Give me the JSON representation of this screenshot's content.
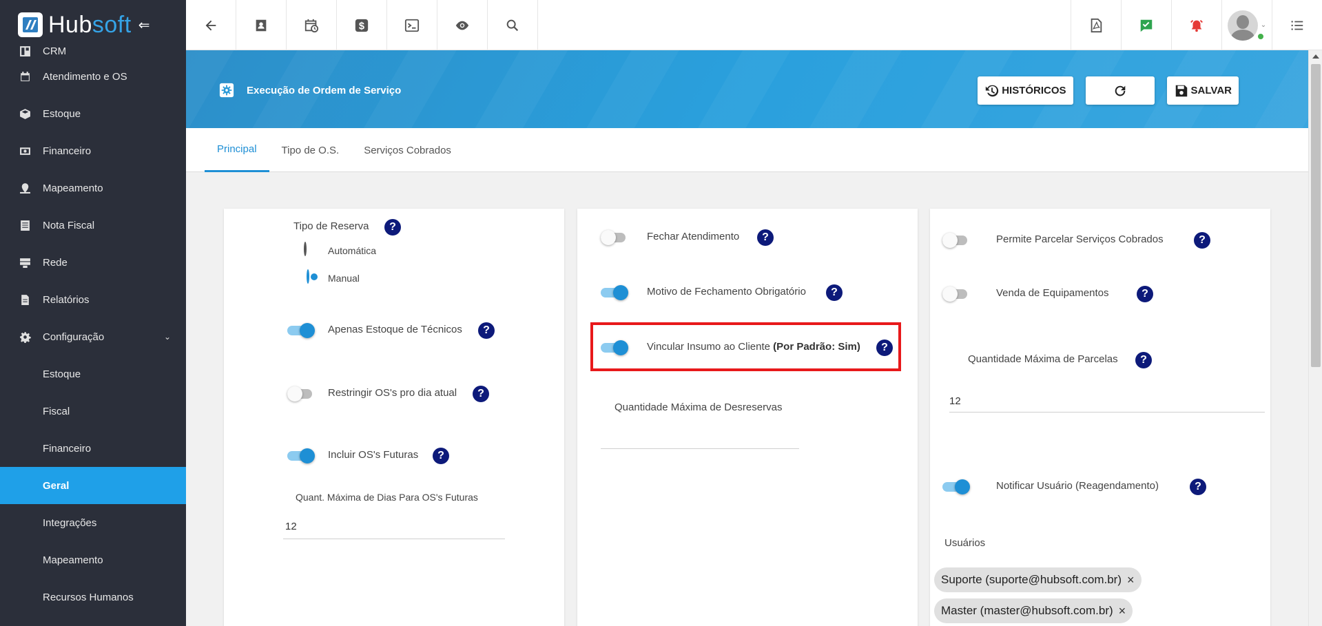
{
  "brand": {
    "name_part1": "Hub",
    "name_part2": "soft",
    "collapse_glyph": "⇐"
  },
  "sidebar": {
    "items": [
      {
        "label": "CRM",
        "icon": "crm-icon"
      },
      {
        "label": "Atendimento e OS",
        "icon": "calendar-clock-icon"
      },
      {
        "label": "Estoque",
        "icon": "box-icon"
      },
      {
        "label": "Financeiro",
        "icon": "money-icon"
      },
      {
        "label": "Mapeamento",
        "icon": "map-pin-icon"
      },
      {
        "label": "Nota Fiscal",
        "icon": "receipt-icon"
      },
      {
        "label": "Rede",
        "icon": "server-icon"
      },
      {
        "label": "Relatórios",
        "icon": "report-icon"
      },
      {
        "label": "Configuração",
        "icon": "gear-icon"
      }
    ],
    "sub_items": [
      "Estoque",
      "Fiscal",
      "Financeiro",
      "Geral",
      "Integrações",
      "Mapeamento",
      "Recursos Humanos"
    ],
    "active_sub": "Geral"
  },
  "topbar": {
    "left_icons": [
      "back-arrow-icon",
      "contact-icon",
      "calendar-icon",
      "dollar-icon",
      "terminal-icon",
      "eye-icon",
      "search-icon"
    ],
    "right_icons": [
      "pdf-icon",
      "task-check-icon",
      "alarm-icon",
      "user-avatar",
      "list-menu-icon"
    ]
  },
  "header": {
    "title": "Execução de Ordem de Serviço",
    "historicos_label": "HISTÓRICOS",
    "salvar_label": "SALVAR"
  },
  "tabs": [
    {
      "label": "Principal",
      "active": true
    },
    {
      "label": "Tipo de O.S.",
      "active": false
    },
    {
      "label": "Serviços Cobrados",
      "active": false
    }
  ],
  "card1": {
    "tipo_reserva_label": "Tipo de Reserva",
    "radio_automatica": "Automática",
    "radio_manual": "Manual",
    "selected": "Manual",
    "apenas_estoque": {
      "label": "Apenas Estoque de Técnicos",
      "on": true
    },
    "restringir": {
      "label": "Restringir OS's pro dia atual",
      "on": false
    },
    "incluir_futuras": {
      "label": "Incluir OS's Futuras",
      "on": true
    },
    "quant_dias_label": "Quant. Máxima de Dias Para OS's Futuras",
    "quant_dias_value": "12"
  },
  "card2": {
    "fechar_atendimento": {
      "label": "Fechar Atendimento",
      "on": false
    },
    "motivo_fechamento": {
      "label": "Motivo de Fechamento Obrigatório",
      "on": true
    },
    "vincular_insumo": {
      "label": "Vincular Insumo ao Cliente",
      "bold_suffix": "(Por Padrão: Sim)",
      "on": true
    },
    "qtd_desreservas_label": "Quantidade Máxima de Desreservas",
    "qtd_desreservas_value": ""
  },
  "card3": {
    "permite_parcelar": {
      "label": "Permite Parcelar Serviços Cobrados",
      "on": false
    },
    "venda_equipamentos": {
      "label": "Venda de Equipamentos",
      "on": false
    },
    "qtd_parcelas_label": "Quantidade Máxima de Parcelas",
    "qtd_parcelas_value": "12",
    "notificar_usuario": {
      "label": "Notificar Usuário (Reagendamento)",
      "on": true
    },
    "usuarios_label": "Usuários",
    "usuarios": [
      "Suporte (suporte@hubsoft.com.br)",
      "Master (master@hubsoft.com.br)"
    ]
  },
  "help_glyph": "?",
  "chip_remove_glyph": "×",
  "colors": {
    "sidebar_bg": "#2b2f3a",
    "accent": "#1e8fd5",
    "active_nav": "#1fa0e8",
    "help_bg": "#0d1a7a",
    "highlight": "#e8191b"
  }
}
